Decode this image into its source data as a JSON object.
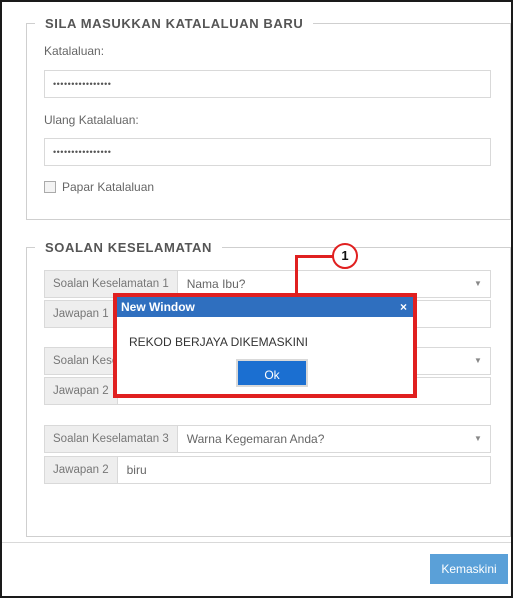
{
  "form": {
    "new_password_legend": "SILA MASUKKAN KATALALUAN BARU",
    "password_label": "Katalaluan:",
    "password_value": "••••••••••••••••",
    "repeat_password_label": "Ulang Katalaluan:",
    "repeat_password_value": "••••••••••••••••",
    "show_password_label": "Papar Katalaluan"
  },
  "security": {
    "legend": "SOALAN KESELAMATAN",
    "q1_label": "Soalan Keselamatan 1",
    "q1_value": "Nama Ibu?",
    "a1_label": "Jawapan 1",
    "q2_label": "Soalan Keselamatan 2",
    "a2_label": "Jawapan 2",
    "q3_label": "Soalan Keselamatan 3",
    "q3_value": "Warna Kegemaran Anda?",
    "a3_label": "Jawapan 2",
    "a3_value": "biru"
  },
  "actions": {
    "update_label": "Kemaskini"
  },
  "dialog": {
    "title": "New Window",
    "close": "×",
    "message": "REKOD BERJAYA DIKEMASKINI",
    "ok_label": "Ok"
  },
  "callout": {
    "number": "1",
    "color": "#e02020"
  }
}
